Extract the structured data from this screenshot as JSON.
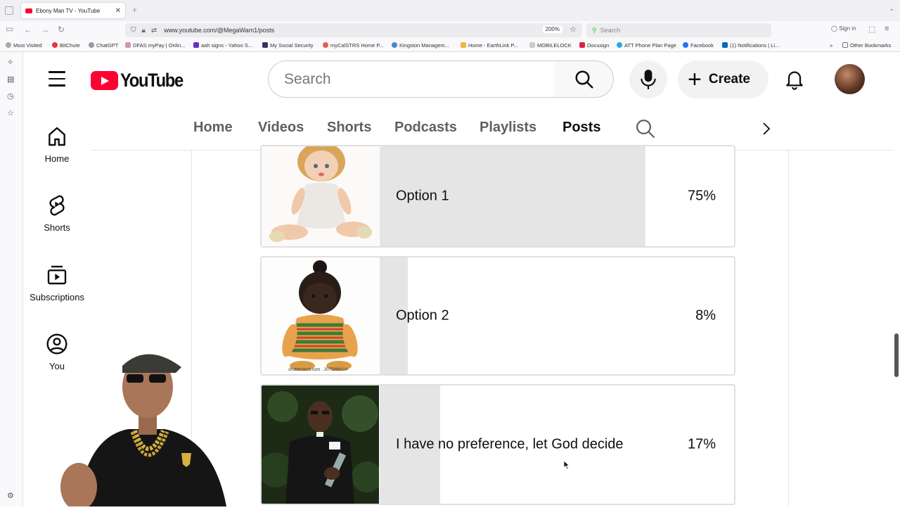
{
  "browser": {
    "tab_title": "Ebony Man TV - YouTube",
    "url": "www.youtube.com/@MegaWam1/posts",
    "zoom": "200%",
    "search_placeholder": "Search",
    "signin": "Sign in",
    "bookmarks": [
      "Most Visited",
      "BitChute",
      "ChatGPT",
      "DFAS myPay | Onlin...",
      "aah signs - Yahoo S...",
      "My Social Security",
      "myCalSTRS Home P...",
      "Kingston Managem...",
      "Home - EarthLink P...",
      "MOBILELOCK",
      "Docusign",
      "ATT Phone Plan Page",
      "Facebook",
      "(1) Notifications | Li..."
    ],
    "other_bookmarks": "Other Bookmarks"
  },
  "youtube": {
    "logo_text": "YouTube",
    "search_placeholder": "Search",
    "create_label": "Create",
    "guide": [
      {
        "label": "Home",
        "icon": "home-icon"
      },
      {
        "label": "Shorts",
        "icon": "shorts-icon"
      },
      {
        "label": "Subscriptions",
        "icon": "subscriptions-icon"
      },
      {
        "label": "You",
        "icon": "you-icon"
      }
    ],
    "channel_tabs": [
      "Home",
      "Videos",
      "Shorts",
      "Podcasts",
      "Playlists",
      "Posts"
    ],
    "active_tab": "Posts"
  },
  "poll": {
    "options": [
      {
        "label": "Option 1",
        "percent": "75%",
        "value": 75,
        "image": "white-doll-image"
      },
      {
        "label": "Option 2",
        "percent": "8%",
        "value": 8,
        "image": "black-doll-image",
        "watermark": "shutterstock.com · 2075868214"
      },
      {
        "label": "I have no preference, let God decide",
        "percent": "17%",
        "value": 17,
        "image": "man-portrait-image"
      }
    ],
    "fill_color": "#e5e5e5"
  }
}
